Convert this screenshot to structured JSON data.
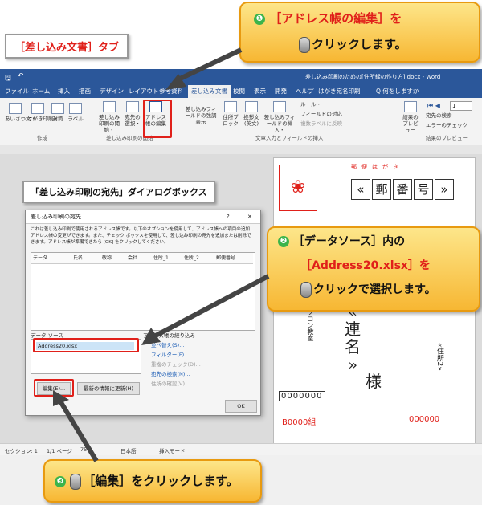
{
  "callouts": {
    "step1_line1": "［アドレス帳の編集］を",
    "step1_line2": "クリックします。",
    "step2_line1": "［データソース］内の",
    "step2_line2": "［Address20.xlsx］を",
    "step2_line3": "クリックで選択します。",
    "step3_text": "［編集］をクリックします。",
    "step1_num": "❶",
    "step2_num": "❷",
    "step3_num": "❸"
  },
  "labels": {
    "tab_label": "［差し込み文書］タブ",
    "dialog_label": "「差し込み印刷の宛先」ダイアログボックス"
  },
  "word": {
    "title": "差し込み印刷のための[住所録の作り方].docx - Word",
    "tabs": [
      "ファイル",
      "ホーム",
      "挿入",
      "描画",
      "デザイン",
      "レイアウト",
      "参考資料",
      "差し込み文書",
      "校閲",
      "表示",
      "開発",
      "ヘルプ",
      "はがき宛名印刷",
      "Q 何をしますか"
    ],
    "ribbon": {
      "greetings": "あいさつ文・",
      "postcard": "はがき印刷・",
      "envelope": "封筒",
      "label": "ラベル",
      "start_merge": "差し込み印刷の開始・",
      "select_recipients": "宛先の選択・",
      "edit_list": "アドレス帳の編集",
      "highlight": "差し込みフィールドの強調表示",
      "address_block": "住所ブロック",
      "greeting_line": "挨拶文(英文)",
      "insert_field": "差し込みフィールドの挿入・",
      "rules": "ルール・",
      "match_fields": "フィールドの対応",
      "update_labels": "複数ラベルに反映",
      "preview": "結果のプレビュー",
      "find_recipient": "宛先の検索",
      "check_errors": "エラーのチェック",
      "group_create": "作成",
      "group_start": "差し込み印刷の開始",
      "group_write": "文章入力とフィールドの挿入",
      "group_preview": "結果のプレビュー",
      "record_num": "1"
    },
    "status": {
      "section": "セクション: 1",
      "page": "1/1 ページ",
      "zoom_frag": "75",
      "lang": "日本語",
      "mode": "挿入モード"
    }
  },
  "dialog": {
    "title": "差し込み印刷の宛先",
    "help": "?",
    "close": "✕",
    "description": "これは差し込み印刷で使用されるアドレス帳です。以下のオプションを使用して、アドレス帳への項目の追加、アドレス帳の変更ができます。また、チェック ボックスを使用して、差し込み印刷の宛先を追加または削除できます。アドレス帳が準備できたら [OK] をクリックしてください。",
    "columns": [
      "データ...",
      "",
      "氏名",
      "敬称",
      "会社",
      "住所_1",
      "住所_2",
      "郵便番号"
    ],
    "datasource_label": "データ ソース",
    "datasource_item": "Address20.xlsx",
    "refine_label": "アドレス帳の絞り込み",
    "links": [
      "並べ替え(S)...",
      "フィルター(F)...",
      "重複のチェック(D)...",
      "宛先の検索(N)...",
      "住所の確認(V)..."
    ],
    "edit_btn": "編集(E)...",
    "refresh_btn": "最新の情報に更新(H)",
    "ok_btn": "OK"
  },
  "postcard": {
    "header": "郵便はがき",
    "postal_fields": [
      "«",
      "郵",
      "番",
      "号",
      "»"
    ],
    "name_chars": [
      "«",
      "連",
      "名",
      "»"
    ],
    "sama": "様",
    "address": "«住所2»",
    "sender_vertical": "パソコン教室",
    "sender_code": "0000000",
    "bottom_left": "B0000組",
    "bottom_right": "000000"
  }
}
